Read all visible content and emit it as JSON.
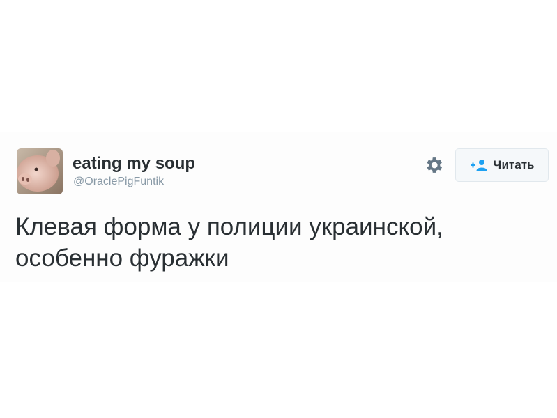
{
  "tweet": {
    "author": {
      "display_name": "eating my soup",
      "handle": "@OraclePigFuntik",
      "avatar_icon": "pig-avatar-icon"
    },
    "settings_icon": "gear-icon",
    "follow_button": {
      "label": "Читать",
      "icon": "follow-user-icon",
      "accent_color": "#1da1f2"
    },
    "text_lines": [
      "Клевая форма у полиции украинской,",
      "особенно фуражки"
    ]
  }
}
